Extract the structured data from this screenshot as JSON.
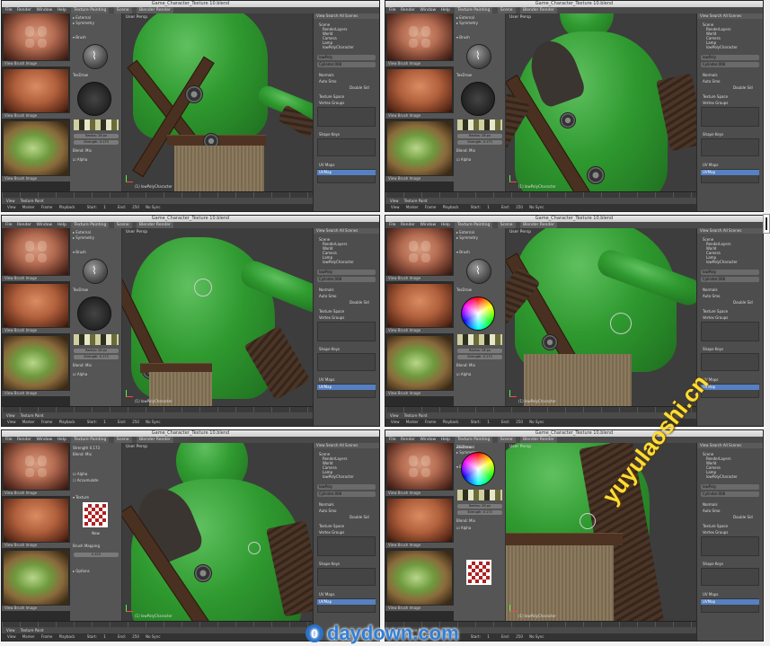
{
  "frames": [
    {
      "title": "Game_Character_Texture 10.blend",
      "variant": "front-chest"
    },
    {
      "title": "Game_Character_Texture 10.blend",
      "variant": "front-chest-close"
    },
    {
      "title": "Game_Character_Texture 10.blend",
      "variant": "shoulder"
    },
    {
      "title": "Game_Character_Texture 10.blend",
      "variant": "arm-colorwheel"
    },
    {
      "title": "Game_Character_Texture 10.blend",
      "variant": "face-texture"
    },
    {
      "title": "Game_Character_Texture 10.blend",
      "variant": "closeup-arm"
    }
  ],
  "menu": {
    "file": "File",
    "render": "Render",
    "window": "Window",
    "help": "Help",
    "workspace": "Texture Painting",
    "scene": "Scene",
    "engine": "Blender Render"
  },
  "refs": {
    "view": "View",
    "brush": "Brush",
    "image": "Image"
  },
  "toolshelf": {
    "external": "External",
    "symmetry": "Symmetry",
    "brush": "Brush",
    "texdraw": "TexDraw",
    "radius_label": "Radius",
    "radius": "28 px",
    "strength_label": "Strength",
    "strength": "0.173",
    "blend_label": "Blend",
    "blend": "Mix",
    "alpha": "Alpha",
    "accumulate": "Accumulate",
    "texture": "Texture",
    "new": "New",
    "options": "Options",
    "brush_mapping": "Brush Mapping",
    "angle": "0.123"
  },
  "viewport": {
    "view_label": "User Persp",
    "object_label": "(1) lowPolyCharacter"
  },
  "rightpanel": {
    "search_view": "View",
    "search_label": "Search",
    "all_scenes": "All Scenes",
    "outliner": [
      "Scene",
      "RenderLayers",
      "World",
      "Camera",
      "Lamp",
      "lowPolyCharacter"
    ],
    "obj_name": "lowPoly",
    "mesh_name": "Cylinder.008",
    "normals": "Normals",
    "auto_smooth": "Auto Smo",
    "double_sided": "Double Sid",
    "texture_space": "Texture Space",
    "vertex_groups": "Vertex Groups",
    "shape_keys": "Shape Keys",
    "uv_maps": "UV Maps",
    "uv_map": "UVMap"
  },
  "timeline": {
    "view": "View",
    "marker": "Marker",
    "frame": "Frame",
    "playback": "Playback",
    "start": "Start",
    "start_val": "1",
    "end": "End",
    "end_val": "250",
    "no_sync": "No Sync",
    "mode": "Texture Paint"
  },
  "watermarks": {
    "vertical": "yuyulaoshi.cn",
    "bottom": "daydown.com",
    "badge": "0"
  }
}
